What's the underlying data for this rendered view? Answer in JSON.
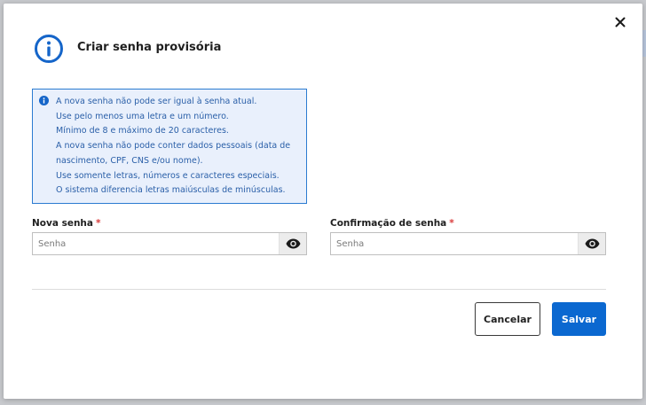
{
  "dialog": {
    "title": "Criar senha provisória",
    "close_icon": "close-icon",
    "title_icon": "info-circle-icon"
  },
  "alert": {
    "icon": "info-icon",
    "lines": [
      "A nova senha não pode ser igual à senha atual.",
      "Use pelo menos uma letra e um número.",
      "Mínimo de 8 e máximo de 20 caracteres.",
      "A nova senha não pode conter dados pessoais (data de",
      "nascimento, CPF, CNS e/ou nome).",
      "Use somente letras, números e caracteres especiais.",
      "O sistema diferencia letras maiúsculas de minúsculas."
    ]
  },
  "fields": {
    "new_password": {
      "label": "Nova senha",
      "required_marker": "*",
      "placeholder": "Senha",
      "value": "",
      "toggle_icon": "eye-icon"
    },
    "confirm_password": {
      "label": "Confirmação de senha",
      "required_marker": "*",
      "placeholder": "Senha",
      "value": "",
      "toggle_icon": "eye-icon"
    }
  },
  "actions": {
    "cancel_label": "Cancelar",
    "save_label": "Salvar"
  },
  "colors": {
    "primary": "#0b68d0",
    "alert_background": "#e9f0fc",
    "alert_border": "#2b7bd1",
    "alert_text": "#2a5fa8",
    "required": "#d93a3a"
  }
}
